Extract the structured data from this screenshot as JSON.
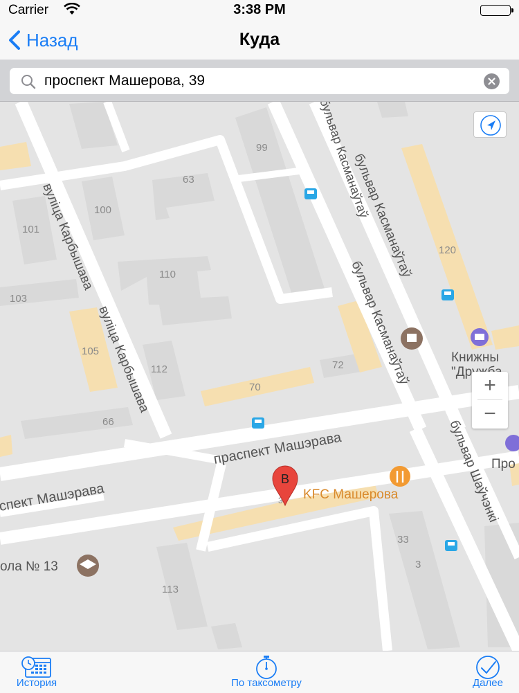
{
  "status_bar": {
    "carrier": "Carrier",
    "time": "3:38 PM"
  },
  "nav": {
    "back_label": "Назад",
    "title": "Куда"
  },
  "search": {
    "value": "проспект Машерова, 39"
  },
  "map": {
    "street_labels": {
      "karbyshava_1": "вуліца Карбышава",
      "karbyshava_2": "вуліца Карбышава",
      "kasmanautau_top": "бульвар Касманаўтаў",
      "kasmanautau_1": "бульвар Касманаўтаў",
      "kasmanautau_2": "бульвар Касманаўтаў",
      "masherava_1": "праспект Машэрава",
      "masherava_2": "спект Машэрава",
      "shauchenki": "бульвар Шаўчэнкі"
    },
    "building_numbers": {
      "b99": "99",
      "b63": "63",
      "b100": "100",
      "b101": "101",
      "b110": "110",
      "b103": "103",
      "b105": "105",
      "b112": "112",
      "b120": "120",
      "b72": "72",
      "b70": "70",
      "b66": "66",
      "b39": "39",
      "b33": "33",
      "b3": "3",
      "b113": "113"
    },
    "poi_labels": {
      "kfc": "KFC Машерова",
      "knizhny_1": "Книжны",
      "knizhny_2": "\"Дружба",
      "school": "ола № 13",
      "pro": "Про"
    },
    "marker_label": "B",
    "zoom_in": "+",
    "zoom_out": "−",
    "colors": {
      "road": "#ffffff",
      "block": "#e4e4e4",
      "building": "#d9d9d9",
      "highlight": "#f6dfb0",
      "bus": "#2aa7e6",
      "marker": "#e8453c",
      "poi": "#8c7262",
      "kfc": "#f29a32"
    }
  },
  "tabs": [
    {
      "label": "История",
      "icon": "calendar-clock-icon"
    },
    {
      "label": "По таксометру",
      "icon": "stopwatch-icon"
    },
    {
      "label": "Далее",
      "icon": "checkmark-circle-icon"
    }
  ]
}
